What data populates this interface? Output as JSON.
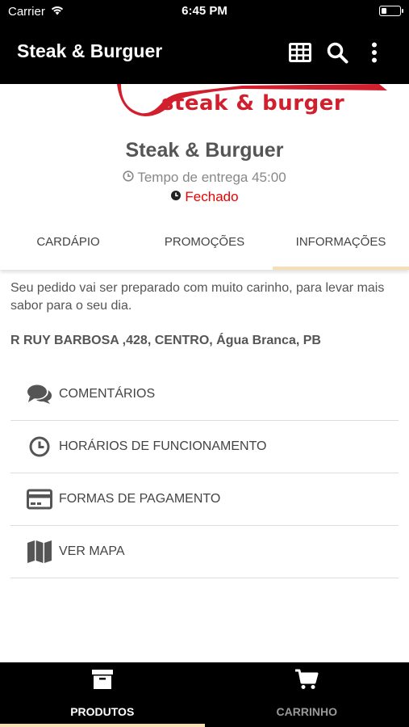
{
  "status_bar": {
    "carrier": "Carrier",
    "time": "6:45 PM",
    "battery_level": 0.3
  },
  "app_bar": {
    "title": "Steak & Burguer",
    "icons": [
      "grid-icon",
      "search-icon",
      "more-vert-icon"
    ]
  },
  "banner": {
    "text": "steak & burger",
    "brand_color": "#d11f2e"
  },
  "store": {
    "name": "Steak & Burguer",
    "delivery_time": "Tempo de entrega 45:00",
    "status": "Fechado",
    "status_color": "#e00000"
  },
  "tabs": [
    {
      "label": "CARDÁPIO",
      "active": false
    },
    {
      "label": "PROMOÇÕES",
      "active": false
    },
    {
      "label": "INFORMAÇÕES",
      "active": true
    }
  ],
  "info": {
    "description": "Seu pedido vai ser preparado com muito carinho, para levar mais sabor para o seu dia.",
    "address": "R RUY BARBOSA ,428, CENTRO, Água Branca, PB",
    "items": [
      {
        "label": "COMENTÁRIOS",
        "icon": "comments-icon"
      },
      {
        "label": "HORÁRIOS DE FUNCIONAMENTO",
        "icon": "clock-icon"
      },
      {
        "label": "FORMAS DE PAGAMENTO",
        "icon": "credit-card-icon"
      },
      {
        "label": "VER MAPA",
        "icon": "map-icon"
      }
    ]
  },
  "bottom_nav": [
    {
      "label": "PRODUTOS",
      "icon": "archive-box-icon",
      "active": true
    },
    {
      "label": "CARRINHO",
      "icon": "cart-icon",
      "active": false
    }
  ],
  "accent_color": "#f6dfb5"
}
